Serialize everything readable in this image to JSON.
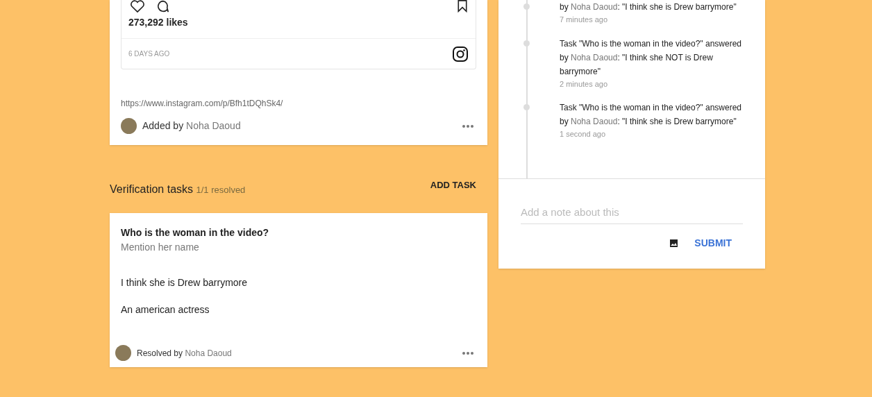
{
  "post": {
    "likes": "273,292 likes",
    "age": "6 DAYS AGO",
    "url": "https://www.instagram.com/p/Bfh1tDQhSk4/",
    "added_label": "Added by",
    "added_by": "Noha Daoud"
  },
  "tasks_header": {
    "title": "Verification tasks",
    "count": "1/1 resolved",
    "action": "ADD TASK"
  },
  "task": {
    "question": "Who is the woman in the video?",
    "hint": "Mention her name",
    "answers": [
      "I think she is Drew barrymore",
      "An american actress"
    ],
    "resolved_label": "Resolved by",
    "resolved_by": "Noha Daoud"
  },
  "timeline": [
    {
      "before": "by",
      "author": "Noha Daoud",
      "after": ": \"I think she is Drew barrymore\"",
      "time": "7 minutes ago"
    },
    {
      "before": "Task \"Who is the woman in the video?\" answered by",
      "author": "Noha Daoud",
      "after": ": \"I think she NOT is Drew barrymore\"",
      "time": "2 minutes ago"
    },
    {
      "before": "Task \"Who is the woman in the video?\" answered by",
      "author": "Noha Daoud",
      "after": ": \"I think she is Drew barrymore\"",
      "time": "1 second ago"
    }
  ],
  "note": {
    "placeholder": "Add a note about this",
    "submit": "SUBMIT"
  }
}
